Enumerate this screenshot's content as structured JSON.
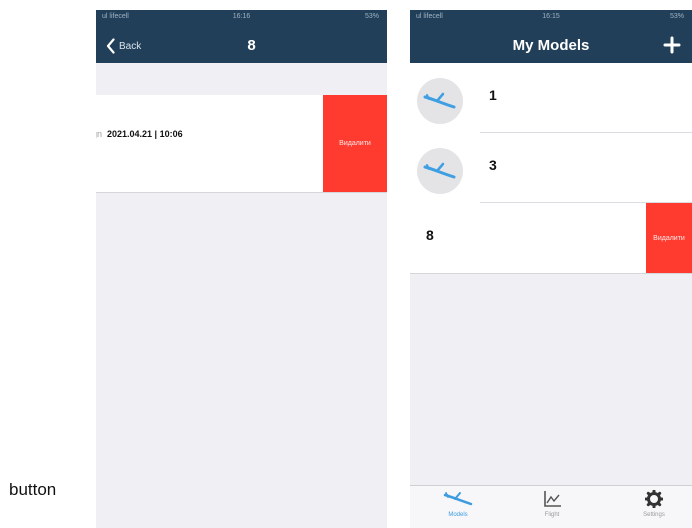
{
  "caption": "button",
  "left_screen": {
    "status": {
      "carrier": "ul lifecell",
      "time": "16:16",
      "battery": "53%"
    },
    "nav": {
      "back_label": "Back",
      "title": "8"
    },
    "detail": {
      "label": "ign",
      "value": "2021.04.21 | 10:06"
    },
    "delete_label": "Видалити"
  },
  "right_screen": {
    "status": {
      "carrier": "ul lifecell",
      "time": "16:15",
      "battery": "53%"
    },
    "nav": {
      "title": "My Models"
    },
    "models": [
      {
        "name": "1"
      },
      {
        "name": "3"
      },
      {
        "name": "8"
      }
    ],
    "delete_label": "Видалити",
    "tabs": [
      {
        "label": "Models",
        "icon": "plane-icon",
        "active": true
      },
      {
        "label": "Flight",
        "icon": "chart-icon",
        "active": false
      },
      {
        "label": "Settings",
        "icon": "gear-icon",
        "active": false
      }
    ]
  },
  "colors": {
    "nav_bg": "#213f58",
    "delete_red": "#ff3b30",
    "accent_blue": "#3d9be0",
    "background": "#efeff4"
  }
}
